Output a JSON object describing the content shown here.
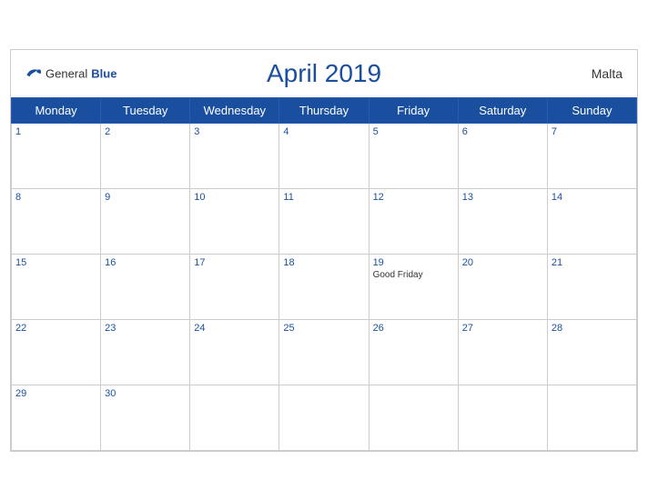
{
  "header": {
    "title": "April 2019",
    "country": "Malta",
    "logo_general": "General",
    "logo_blue": "Blue"
  },
  "weekdays": [
    "Monday",
    "Tuesday",
    "Wednesday",
    "Thursday",
    "Friday",
    "Saturday",
    "Sunday"
  ],
  "weeks": [
    [
      {
        "day": "1",
        "holiday": ""
      },
      {
        "day": "2",
        "holiday": ""
      },
      {
        "day": "3",
        "holiday": ""
      },
      {
        "day": "4",
        "holiday": ""
      },
      {
        "day": "5",
        "holiday": ""
      },
      {
        "day": "6",
        "holiday": ""
      },
      {
        "day": "7",
        "holiday": ""
      }
    ],
    [
      {
        "day": "8",
        "holiday": ""
      },
      {
        "day": "9",
        "holiday": ""
      },
      {
        "day": "10",
        "holiday": ""
      },
      {
        "day": "11",
        "holiday": ""
      },
      {
        "day": "12",
        "holiday": ""
      },
      {
        "day": "13",
        "holiday": ""
      },
      {
        "day": "14",
        "holiday": ""
      }
    ],
    [
      {
        "day": "15",
        "holiday": ""
      },
      {
        "day": "16",
        "holiday": ""
      },
      {
        "day": "17",
        "holiday": ""
      },
      {
        "day": "18",
        "holiday": ""
      },
      {
        "day": "19",
        "holiday": "Good Friday"
      },
      {
        "day": "20",
        "holiday": ""
      },
      {
        "day": "21",
        "holiday": ""
      }
    ],
    [
      {
        "day": "22",
        "holiday": ""
      },
      {
        "day": "23",
        "holiday": ""
      },
      {
        "day": "24",
        "holiday": ""
      },
      {
        "day": "25",
        "holiday": ""
      },
      {
        "day": "26",
        "holiday": ""
      },
      {
        "day": "27",
        "holiday": ""
      },
      {
        "day": "28",
        "holiday": ""
      }
    ],
    [
      {
        "day": "29",
        "holiday": ""
      },
      {
        "day": "30",
        "holiday": ""
      },
      {
        "day": "",
        "holiday": ""
      },
      {
        "day": "",
        "holiday": ""
      },
      {
        "day": "",
        "holiday": ""
      },
      {
        "day": "",
        "holiday": ""
      },
      {
        "day": "",
        "holiday": ""
      }
    ]
  ]
}
